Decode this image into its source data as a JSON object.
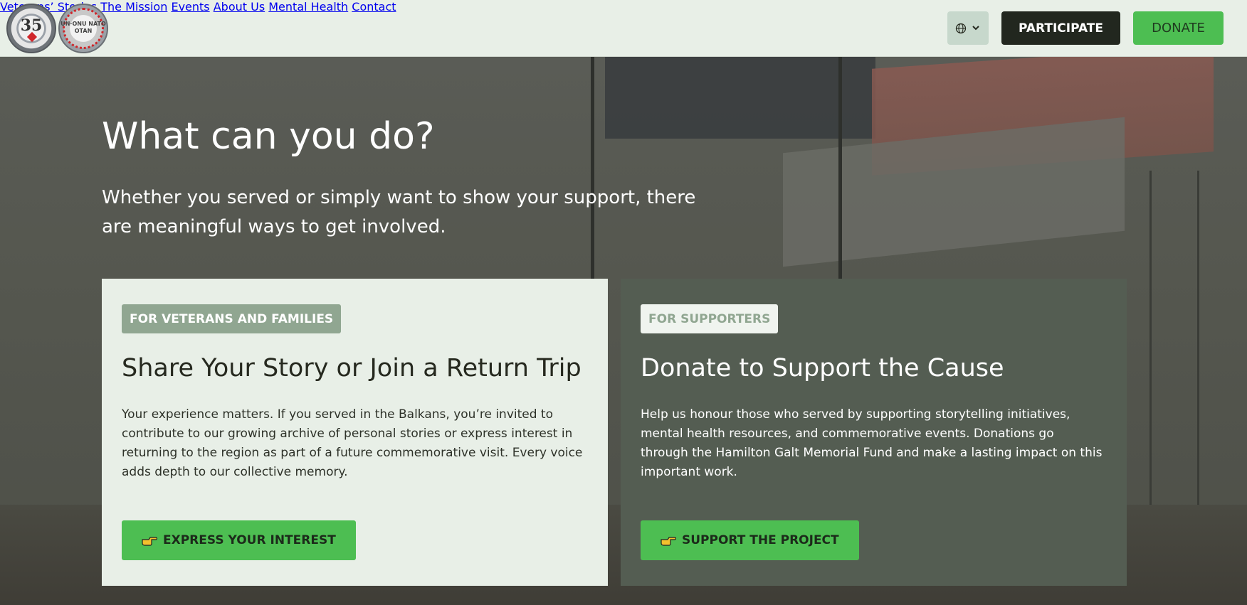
{
  "logos": {
    "left_text": "35",
    "right_text": "UN·ONU NATO OTAN"
  },
  "nav": {
    "items": [
      {
        "label": "Veterans’ Stories"
      },
      {
        "label": "The Mission"
      },
      {
        "label": "Events"
      },
      {
        "label": "About Us"
      },
      {
        "label": "Mental Health"
      },
      {
        "label": "Contact"
      }
    ],
    "language_icon": "globe-icon",
    "participate_label": "PARTICIPATE",
    "donate_label": "DONATE"
  },
  "hero": {
    "title": "What can you do?",
    "subtitle": "Whether you served or simply want to show your support, there are meaningful ways to get involved."
  },
  "cards": [
    {
      "badge": "FOR VETERANS AND FAMILIES",
      "title": "Share Your Story or Join a Return Trip",
      "body": "Your experience matters. If you served in the Balkans, you’re invited to contribute to our growing archive of personal stories or express interest in returning to the region as part of a future commemorative visit. Every voice adds depth to our collective memory.",
      "button": "EXPRESS YOUR INTEREST"
    },
    {
      "badge": "FOR SUPPORTERS",
      "title": "Donate to Support the Cause",
      "body": "Help us honour those who served by supporting storytelling initiatives, mental health resources, and commemorative events. Donations go through the Hamilton Galt Memorial Fund and make a lasting impact on this important work.",
      "button": "SUPPORT THE PROJECT"
    }
  ],
  "colors": {
    "accent_green": "#4dbe52",
    "dark": "#22271f",
    "card_light": "#e8efe7",
    "card_dark": "#545d52",
    "badge_green": "#90a691"
  }
}
